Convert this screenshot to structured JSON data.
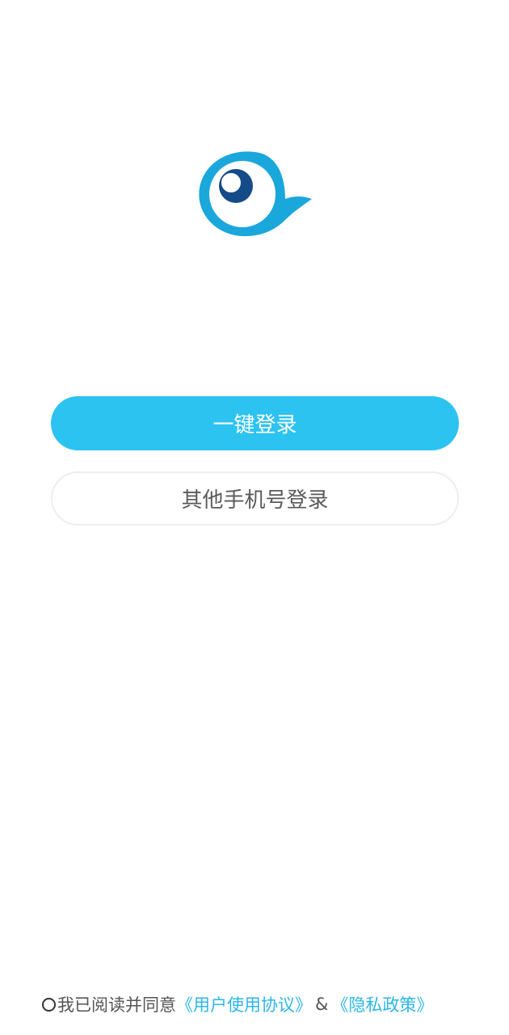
{
  "brand": {
    "logo_icon": "bird-eye-logo-icon",
    "primary_color": "#2cc3f1",
    "logo_color": "#1aa7dc",
    "pupil_color": "#154b88"
  },
  "login": {
    "one_click_label": "一键登录",
    "other_phone_label": "其他手机号登录"
  },
  "agreement": {
    "checkbox_icon": "radio-unchecked-icon",
    "checked": false,
    "prefix": "我已阅读并同意",
    "user_agreement_link": "《用户使用协议》",
    "separator": "&",
    "privacy_policy_link": "《隐私政策》"
  }
}
